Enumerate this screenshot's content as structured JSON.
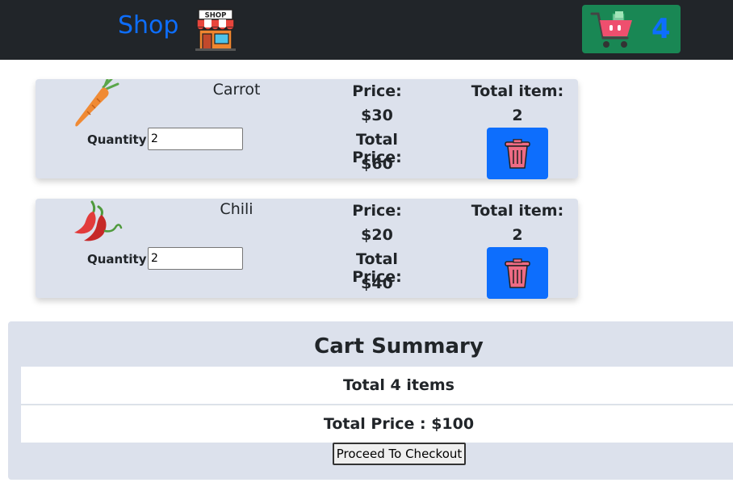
{
  "navbar": {
    "brand": "Shop",
    "shop_icon": "shop-storefront-icon",
    "shop_sign": "SHOP",
    "cart_icon": "shopping-cart-icon",
    "cart_count": "4",
    "colors": {
      "background": "#212529",
      "brand": "#0d6efd",
      "cart_button": "#198754"
    }
  },
  "items": [
    {
      "name": "Carrot",
      "icon": "carrot-icon",
      "quantity_label": "Quantity :",
      "quantity_value": "2",
      "price_label": "Price:",
      "price": "$30",
      "total_price_label": "Total Price:",
      "total_price": "$60",
      "total_item_label": "Total item:",
      "total_item": "2",
      "delete_icon": "trash-icon"
    },
    {
      "name": "Chili",
      "icon": "chili-pepper-icon",
      "quantity_label": "Quantity :",
      "quantity_value": "2",
      "price_label": "Price:",
      "price": "$20",
      "total_price_label": "Total Price:",
      "total_price": "$40",
      "total_item_label": "Total item:",
      "total_item": "2",
      "delete_icon": "trash-icon"
    }
  ],
  "summary": {
    "title": "Cart Summary",
    "total_items": "Total 4 items",
    "total_price": "Total Price : $100",
    "checkout_label": "Proceed To Checkout"
  }
}
